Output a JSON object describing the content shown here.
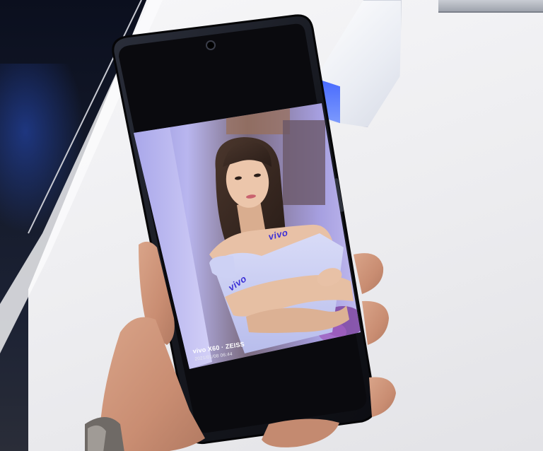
{
  "photo": {
    "screen_caption": {
      "device": "vivo X60 · ZEISS",
      "timestamp": "2021/01/08 06:44"
    },
    "dress_logo_shoulder": "vivo",
    "dress_logo_arm": "vivo"
  },
  "colors": {
    "table": "#ececef",
    "phone_body": "#16181f",
    "screen_lavender": "#b7b3ec",
    "dress": "#c9cdf2",
    "skin": "#e8c1a6",
    "hair": "#3a2a22",
    "logo": "#3b2fd6"
  }
}
